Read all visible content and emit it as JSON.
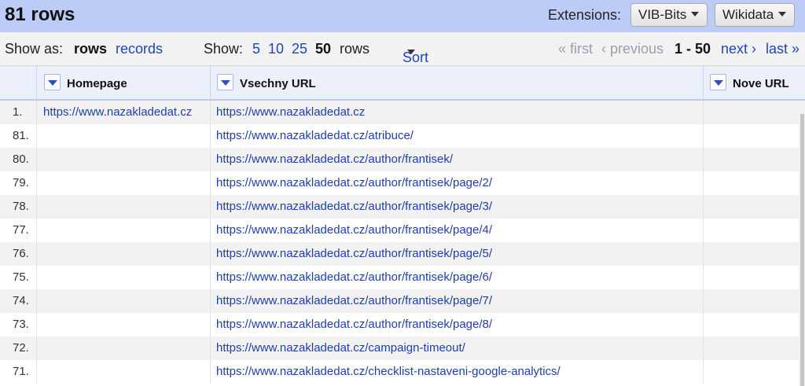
{
  "header": {
    "row_count": "81 rows",
    "extensions_label": "Extensions:",
    "vib_bits": "VIB-Bits",
    "wikidata": "Wikidata"
  },
  "controls": {
    "show_as": "Show as:",
    "rows": "rows",
    "records": "records",
    "show": "Show:",
    "page_sizes": [
      "5",
      "10",
      "25",
      "50"
    ],
    "rows_suffix": "rows",
    "sort": "Sort",
    "first": "« first",
    "previous": "‹ previous",
    "range": "1 - 50",
    "next": "next ›",
    "last": "last »"
  },
  "columns": [
    "Homepage",
    "Vsechny URL",
    "Nove URL"
  ],
  "rows": [
    {
      "num": "1.",
      "homepage": "https://www.nazakladedat.cz",
      "url": "https://www.nazakladedat.cz",
      "new": ""
    },
    {
      "num": "81.",
      "homepage": "",
      "url": "https://www.nazakladedat.cz/atribuce/",
      "new": ""
    },
    {
      "num": "80.",
      "homepage": "",
      "url": "https://www.nazakladedat.cz/author/frantisek/",
      "new": ""
    },
    {
      "num": "79.",
      "homepage": "",
      "url": "https://www.nazakladedat.cz/author/frantisek/page/2/",
      "new": ""
    },
    {
      "num": "78.",
      "homepage": "",
      "url": "https://www.nazakladedat.cz/author/frantisek/page/3/",
      "new": ""
    },
    {
      "num": "77.",
      "homepage": "",
      "url": "https://www.nazakladedat.cz/author/frantisek/page/4/",
      "new": ""
    },
    {
      "num": "76.",
      "homepage": "",
      "url": "https://www.nazakladedat.cz/author/frantisek/page/5/",
      "new": ""
    },
    {
      "num": "75.",
      "homepage": "",
      "url": "https://www.nazakladedat.cz/author/frantisek/page/6/",
      "new": ""
    },
    {
      "num": "74.",
      "homepage": "",
      "url": "https://www.nazakladedat.cz/author/frantisek/page/7/",
      "new": ""
    },
    {
      "num": "73.",
      "homepage": "",
      "url": "https://www.nazakladedat.cz/author/frantisek/page/8/",
      "new": ""
    },
    {
      "num": "72.",
      "homepage": "",
      "url": "https://www.nazakladedat.cz/campaign-timeout/",
      "new": ""
    },
    {
      "num": "71.",
      "homepage": "",
      "url": "https://www.nazakladedat.cz/checklist-nastaveni-google-analytics/",
      "new": ""
    }
  ],
  "colors": {
    "header_bg": "#bcccf7",
    "link": "#1f3fa8",
    "accent": "#2b4fc1"
  }
}
